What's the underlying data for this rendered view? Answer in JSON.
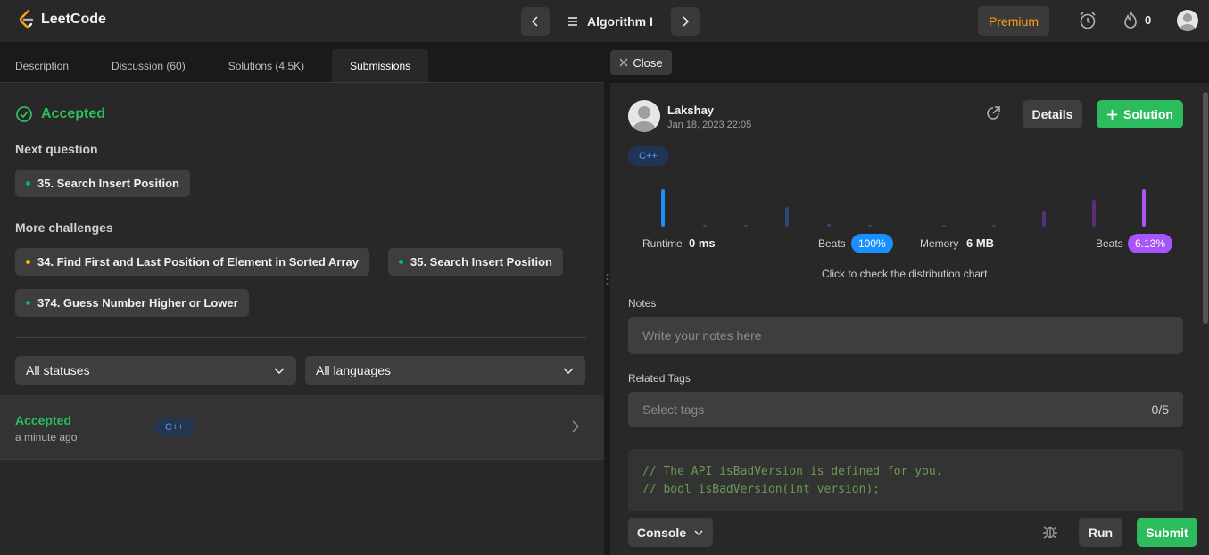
{
  "brand": {
    "name": "LeetCode"
  },
  "topbar": {
    "prev_icon": "chevron-left-icon",
    "list_icon": "list-icon",
    "problem_list": "Algorithm I",
    "next_icon": "chevron-right-icon",
    "premium": "Premium",
    "streak": "0"
  },
  "left": {
    "tabs": [
      "Description",
      "Discussion (60)",
      "Solutions (4.5K)",
      "Submissions"
    ],
    "active_tab": "Submissions",
    "result": "Accepted",
    "next_label": "Next question",
    "next_questions": [
      {
        "title": "35. Search Insert Position",
        "difficulty_color": "#00af9b"
      }
    ],
    "more_label": "More challenges",
    "more_challenges": [
      {
        "title": "34. Find First and Last Position of Element in Sorted Array",
        "difficulty_color": "#ffb800"
      },
      {
        "title": "35. Search Insert Position",
        "difficulty_color": "#00af9b"
      },
      {
        "title": "374. Guess Number Higher or Lower",
        "difficulty_color": "#00af9b"
      }
    ],
    "filters": {
      "status": "All statuses",
      "language": "All languages"
    },
    "submission": {
      "status": "Accepted",
      "time": "a minute ago",
      "language": "C++"
    }
  },
  "right": {
    "close": "Close",
    "user": {
      "name": "Lakshay",
      "date": "Jan 18, 2023 22:05"
    },
    "details": "Details",
    "solution": "Solution",
    "language": "C++",
    "runtime": {
      "label": "Runtime",
      "value": "0 ms",
      "beats_label": "Beats",
      "beats": "100%"
    },
    "memory": {
      "label": "Memory",
      "value": "6 MB",
      "beats_label": "Beats",
      "beats": "6.13%"
    },
    "distribution_link": "Click to check the distribution chart",
    "notes": {
      "label": "Notes",
      "placeholder": "Write your notes here"
    },
    "tags": {
      "label": "Related Tags",
      "placeholder": "Select tags",
      "count": "0/5"
    },
    "code": [
      "// The API isBadVersion is defined for you.",
      "// bool isBadVersion(int version);"
    ],
    "console": "Console",
    "run": "Run",
    "submit": "Submit"
  },
  "colors": {
    "accent_green": "#2cbb5d",
    "premium_orange": "#ffa116",
    "runtime_blue": "#1a90ff",
    "memory_purple": "#a855f7"
  }
}
